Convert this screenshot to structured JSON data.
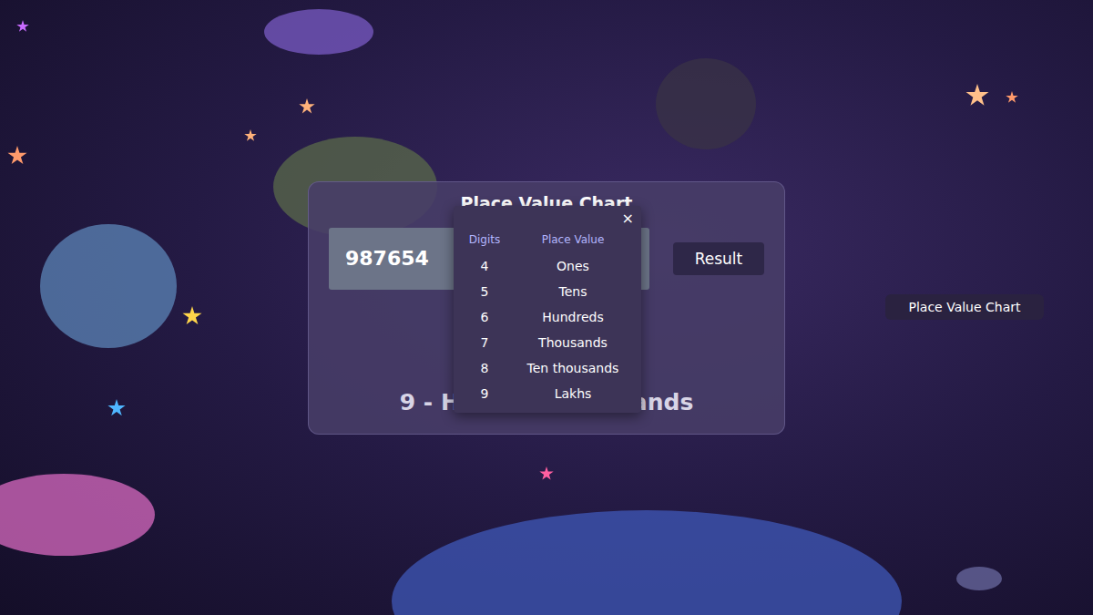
{
  "page": {
    "side_button": "Place Value Chart"
  },
  "panel": {
    "title": "Place Value Chart",
    "input": {
      "value": "987654"
    },
    "button": "Result",
    "result": "9 - Hundred thousands"
  },
  "popup": {
    "close": "×",
    "columns": [
      "Digits",
      "Place Value"
    ],
    "rows": [
      {
        "digit": "4",
        "place": "Ones"
      },
      {
        "digit": "5",
        "place": "Tens"
      },
      {
        "digit": "6",
        "place": "Hundreds"
      },
      {
        "digit": "7",
        "place": "Thousands"
      },
      {
        "digit": "8",
        "place": "Ten thousands"
      },
      {
        "digit": "9",
        "place": "Lakhs"
      }
    ]
  }
}
